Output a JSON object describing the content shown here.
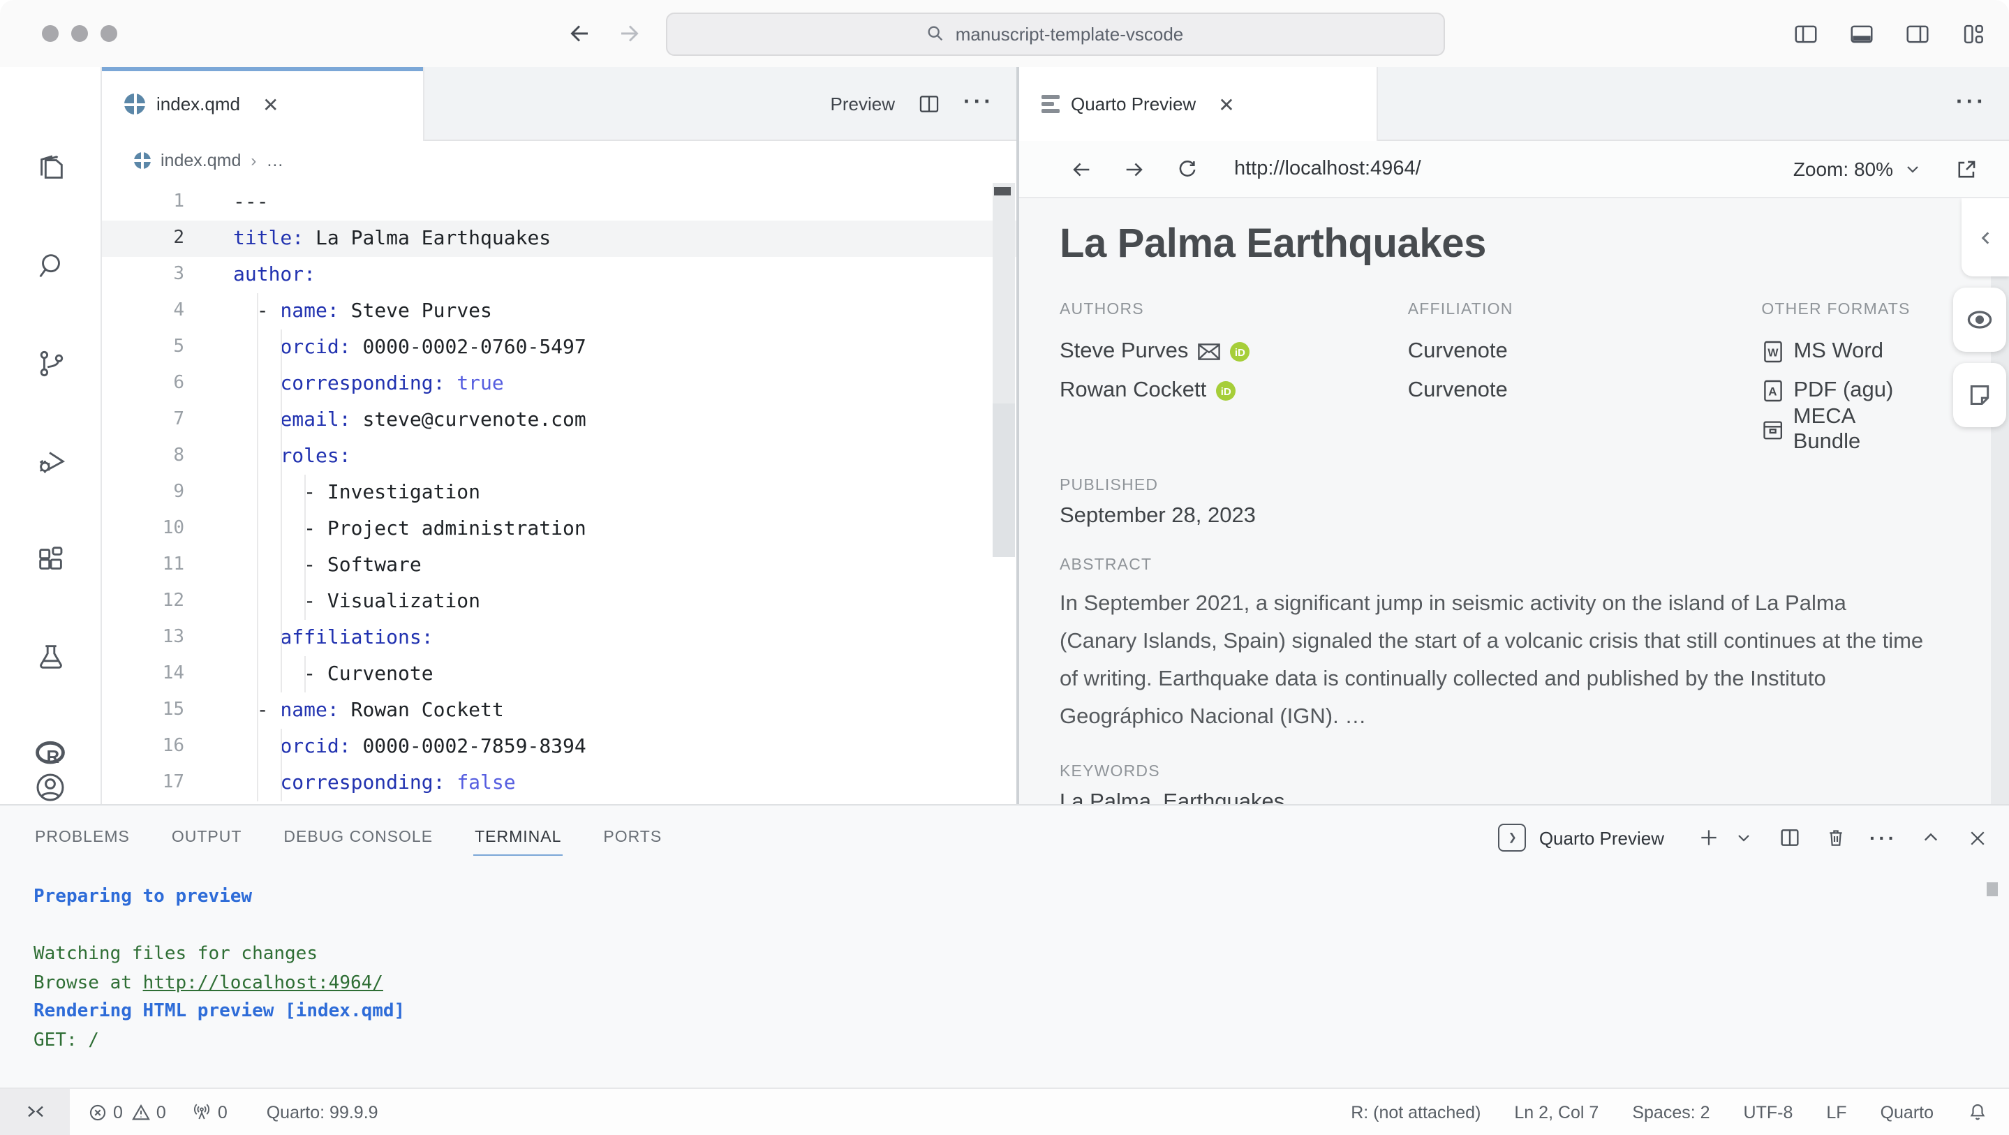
{
  "titlebar": {
    "search_value": "manuscript-template-vscode"
  },
  "activity_bar": {
    "items": [
      "explorer",
      "search",
      "source-control",
      "run-debug",
      "extensions",
      "testing",
      "r-lang"
    ],
    "bottom_items": [
      "account",
      "settings"
    ]
  },
  "editor": {
    "tab_label": "index.qmd",
    "preview_action_label": "Preview",
    "breadcrumb_file": "index.qmd",
    "breadcrumb_more": "…",
    "active_line": 2,
    "lines": [
      {
        "n": 1,
        "tokens": [
          {
            "s": "p",
            "t": "---"
          }
        ]
      },
      {
        "n": 2,
        "tokens": [
          {
            "s": "k",
            "t": "title:"
          },
          {
            "s": "p",
            "t": " La Palma Earthquakes"
          }
        ]
      },
      {
        "n": 3,
        "tokens": [
          {
            "s": "k",
            "t": "author:"
          }
        ]
      },
      {
        "n": 4,
        "tokens": [
          {
            "s": "p",
            "t": "  - "
          },
          {
            "s": "k",
            "t": "name:"
          },
          {
            "s": "p",
            "t": " Steve Purves"
          }
        ]
      },
      {
        "n": 5,
        "tokens": [
          {
            "s": "p",
            "t": "    "
          },
          {
            "s": "k",
            "t": "orcid:"
          },
          {
            "s": "p",
            "t": " 0000-0002-0760-5497"
          }
        ]
      },
      {
        "n": 6,
        "tokens": [
          {
            "s": "p",
            "t": "    "
          },
          {
            "s": "k",
            "t": "corresponding:"
          },
          {
            "s": "b",
            "t": " true"
          }
        ]
      },
      {
        "n": 7,
        "tokens": [
          {
            "s": "p",
            "t": "    "
          },
          {
            "s": "k",
            "t": "email:"
          },
          {
            "s": "p",
            "t": " steve@curvenote.com"
          }
        ]
      },
      {
        "n": 8,
        "tokens": [
          {
            "s": "p",
            "t": "    "
          },
          {
            "s": "k",
            "t": "roles:"
          }
        ]
      },
      {
        "n": 9,
        "tokens": [
          {
            "s": "p",
            "t": "      - Investigation"
          }
        ]
      },
      {
        "n": 10,
        "tokens": [
          {
            "s": "p",
            "t": "      - Project administration"
          }
        ]
      },
      {
        "n": 11,
        "tokens": [
          {
            "s": "p",
            "t": "      - Software"
          }
        ]
      },
      {
        "n": 12,
        "tokens": [
          {
            "s": "p",
            "t": "      - Visualization"
          }
        ]
      },
      {
        "n": 13,
        "tokens": [
          {
            "s": "p",
            "t": "    "
          },
          {
            "s": "k",
            "t": "affiliations:"
          }
        ]
      },
      {
        "n": 14,
        "tokens": [
          {
            "s": "p",
            "t": "      - Curvenote"
          }
        ]
      },
      {
        "n": 15,
        "tokens": [
          {
            "s": "p",
            "t": "  - "
          },
          {
            "s": "k",
            "t": "name:"
          },
          {
            "s": "p",
            "t": " Rowan Cockett"
          }
        ]
      },
      {
        "n": 16,
        "tokens": [
          {
            "s": "p",
            "t": "    "
          },
          {
            "s": "k",
            "t": "orcid:"
          },
          {
            "s": "p",
            "t": " 0000-0002-7859-8394"
          }
        ]
      },
      {
        "n": 17,
        "tokens": [
          {
            "s": "p",
            "t": "    "
          },
          {
            "s": "k",
            "t": "corresponding:"
          },
          {
            "s": "b",
            "t": " false"
          }
        ]
      }
    ]
  },
  "preview": {
    "tab_label": "Quarto Preview",
    "url": "http://localhost:4964/",
    "zoom_label": "Zoom: 80%",
    "article": {
      "title": "La Palma Earthquakes",
      "authors_label": "AUTHORS",
      "affiliation_label": "AFFILIATION",
      "other_formats_label": "OTHER FORMATS",
      "authors": [
        {
          "name": "Steve Purves",
          "has_email": true,
          "has_orcid": true,
          "affiliation": "Curvenote"
        },
        {
          "name": "Rowan Cockett",
          "has_email": false,
          "has_orcid": true,
          "affiliation": "Curvenote"
        }
      ],
      "formats": [
        {
          "icon": "ms-word",
          "label": "MS Word"
        },
        {
          "icon": "pdf",
          "label": "PDF (agu)"
        },
        {
          "icon": "meca",
          "label": "MECA Bundle"
        }
      ],
      "published_label": "PUBLISHED",
      "published": "September 28, 2023",
      "abstract_label": "ABSTRACT",
      "abstract": "In September 2021, a significant jump in seismic activity on the island of La Palma (Canary Islands, Spain) signaled the start of a volcanic crisis that still continues at the time of writing. Earthquake data is continually collected and published by the Instituto Geográphico Nacional (IGN). …",
      "keywords_label": "KEYWORDS",
      "keywords": "La Palma, Earthquakes"
    }
  },
  "panel": {
    "tabs": [
      {
        "label": "PROBLEMS",
        "active": false
      },
      {
        "label": "OUTPUT",
        "active": false
      },
      {
        "label": "DEBUG CONSOLE",
        "active": false
      },
      {
        "label": "TERMINAL",
        "active": true
      },
      {
        "label": "PORTS",
        "active": false
      }
    ],
    "terminal_selector": "Quarto Preview",
    "terminal_lines": [
      {
        "style": "blue",
        "text": "Preparing to preview"
      },
      {
        "style": "plain",
        "text": ""
      },
      {
        "style": "green",
        "text": "Watching files for changes"
      },
      {
        "style": "green",
        "text": "Browse at ",
        "link": "http://localhost:4964/"
      },
      {
        "style": "blue",
        "text": "Rendering HTML preview [index.qmd]"
      },
      {
        "style": "green",
        "text": "GET: /"
      }
    ]
  },
  "statusbar": {
    "left": [
      {
        "icon": "error",
        "label": "0"
      },
      {
        "icon": "warning",
        "label": "0"
      },
      {
        "icon": "broadcast",
        "label": "0"
      },
      {
        "icon": "",
        "label": "Quarto: 99.9.9"
      }
    ],
    "right": [
      "R: (not attached)",
      "Ln 2, Col 7",
      "Spaces: 2",
      "UTF-8",
      "LF",
      "Quarto"
    ]
  },
  "colors": {
    "accent_blue": "#7ba7d7",
    "orcid_green": "#a6ce39",
    "terminal_blue": "#2e6cd8",
    "terminal_green": "#2e6e34",
    "yaml_key": "#2132b0"
  }
}
